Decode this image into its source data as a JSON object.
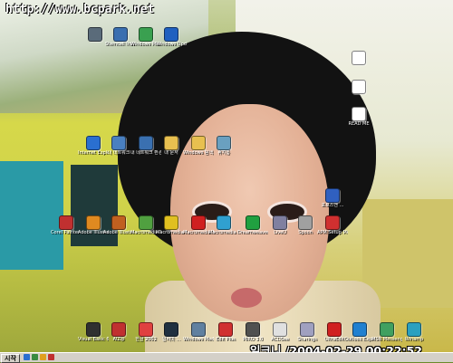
{
  "watermark_url": "http://www.bcpark.net",
  "timestamp_overlay": "일크니 /2004-02-29 00:22:52",
  "taskbar": {
    "start_label": "시작"
  },
  "desktop_icons": [
    {
      "label": "",
      "icon": "app-icon",
      "color": "#5a6b7a"
    },
    {
      "label": "Stemcell Installer",
      "icon": "app-icon",
      "color": "#3a6fb0"
    },
    {
      "label": "Windows Messenger",
      "icon": "messenger-icon",
      "color": "#3aa050"
    },
    {
      "label": "Windows Update",
      "icon": "update-icon",
      "color": "#2060c0"
    },
    {
      "label": "",
      "icon": "document-icon",
      "color": "#ffffff"
    },
    {
      "label": "",
      "icon": "document-icon",
      "color": "#ffffff"
    },
    {
      "label": "READ ME",
      "icon": "document-icon",
      "color": "#ffffff"
    },
    {
      "label": "Internet Explorer",
      "icon": "ie-icon",
      "color": "#2a6fd0"
    },
    {
      "label": "내 네트워크",
      "icon": "network-icon",
      "color": "#4a80c0"
    },
    {
      "label": "내 네트워크 환경",
      "icon": "network-icon",
      "color": "#3a70b0"
    },
    {
      "label": "내 문서",
      "icon": "folder-icon",
      "color": "#e8c050"
    },
    {
      "label": "Windows 탐색기",
      "icon": "explorer-icon",
      "color": "#e8c050"
    },
    {
      "label": "휴지통",
      "icon": "recycle-bin-icon",
      "color": "#6aa0c0"
    },
    {
      "label": "Corel Painter 8",
      "icon": "app-icon",
      "color": "#c03030"
    },
    {
      "label": "Adobe Illustrator",
      "icon": "app-icon",
      "color": "#e08a20"
    },
    {
      "label": "Adobe Illustrator 10",
      "icon": "app-icon",
      "color": "#c06020"
    },
    {
      "label": "Macromedia Dreamweaver",
      "icon": "app-icon",
      "color": "#50a040"
    },
    {
      "label": "Macromedia Fireworks",
      "icon": "app-icon",
      "color": "#e0c020"
    },
    {
      "label": "Macromedia Flash MX",
      "icon": "app-icon",
      "color": "#d02020"
    },
    {
      "label": "Macromedia FreeHand",
      "icon": "app-icon",
      "color": "#30a0d0"
    },
    {
      "label": "Dreamweaver",
      "icon": "app-icon",
      "color": "#20a040"
    },
    {
      "label": "LiveU",
      "icon": "app-icon",
      "color": "#8080a0"
    },
    {
      "label": "Spoon",
      "icon": "app-icon",
      "color": "#a0a0a0"
    },
    {
      "label": "APM Setup Monitor",
      "icon": "app-icon",
      "color": "#d03030"
    },
    {
      "label": "포토스앤 ...",
      "icon": "app-icon",
      "color": "#3060c0"
    },
    {
      "label": "Visual Basic 6.0",
      "icon": "app-icon",
      "color": "#303030"
    },
    {
      "label": "AlZip",
      "icon": "app-icon",
      "color": "#c03030"
    },
    {
      "label": "한글 2002",
      "icon": "app-icon",
      "color": "#e04040"
    },
    {
      "label": "알씨미 ...",
      "icon": "app-icon",
      "color": "#203040"
    },
    {
      "label": "Windows Media Player",
      "icon": "media-player-icon",
      "color": "#6080a0"
    },
    {
      "label": "Edit Plus",
      "icon": "app-icon",
      "color": "#d03030"
    },
    {
      "label": "MIRO 3.0",
      "icon": "app-icon",
      "color": "#505050"
    },
    {
      "label": "ACDSee",
      "icon": "app-icon",
      "color": "#e0e0e0"
    },
    {
      "label": "Sharings",
      "icon": "app-icon",
      "color": "#a0a0c0"
    },
    {
      "label": "UltraEdit",
      "icon": "app-icon",
      "color": "#d02020"
    },
    {
      "label": "Outlook Express",
      "icon": "app-icon",
      "color": "#2080d0"
    },
    {
      "label": "MSN Messenger",
      "icon": "app-icon",
      "color": "#40a060"
    },
    {
      "label": "Winamp",
      "icon": "app-icon",
      "color": "#2aa0c0"
    }
  ]
}
